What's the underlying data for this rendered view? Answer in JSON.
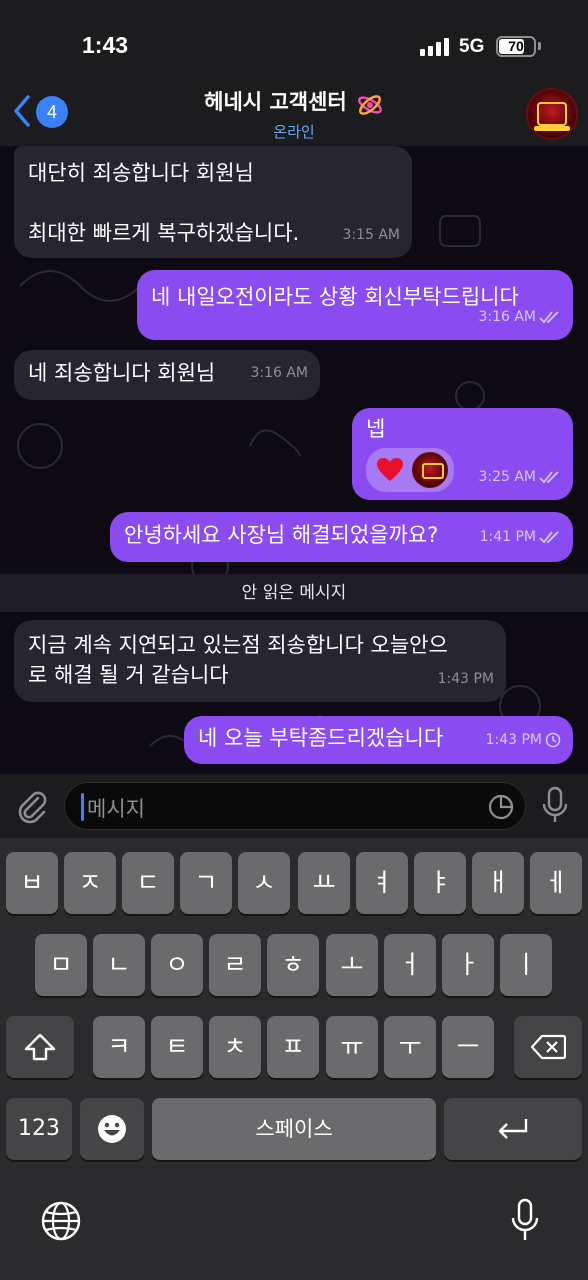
{
  "status_bar": {
    "time": "1:43",
    "network": "5G",
    "battery": "70"
  },
  "header": {
    "back_count": "4",
    "title": "헤네시 고객센터",
    "subtitle": "온라인"
  },
  "messages": [
    {
      "dir": "in",
      "lines": [
        "대단히 죄송합니다 회원님",
        "",
        "최대한 빠르게 복구하겠습니다."
      ],
      "time": "3:15 AM"
    },
    {
      "dir": "out",
      "lines": [
        "네 내일오전이라도 상황 회신부탁드립니다"
      ],
      "time": "3:16 AM",
      "status": "read"
    },
    {
      "dir": "in",
      "lines": [
        "네 죄송합니다 회원님"
      ],
      "time": "3:16 AM"
    },
    {
      "dir": "out",
      "lines": [
        "넵"
      ],
      "time": "3:25 AM",
      "status": "read",
      "reaction": "heart"
    },
    {
      "dir": "out",
      "lines": [
        "안녕하세요 사장님 해결되었을까요?"
      ],
      "time": "1:41 PM",
      "status": "read"
    },
    {
      "dir": "in",
      "lines": [
        "지금 계속 지연되고 있는점 죄송합니다 오늘안으",
        "로 해결 될 거 같습니다"
      ],
      "time": "1:43 PM"
    },
    {
      "dir": "out",
      "lines": [
        "네 오늘 부탁좀드리겠습니다"
      ],
      "time": "1:43 PM",
      "status": "pending"
    }
  ],
  "unread_divider": "안 읽은 메시지",
  "composer": {
    "placeholder": "메시지"
  },
  "keyboard": {
    "row1": [
      "ㅂ",
      "ㅈ",
      "ㄷ",
      "ㄱ",
      "ㅅ",
      "ㅛ",
      "ㅕ",
      "ㅑ",
      "ㅐ",
      "ㅔ"
    ],
    "row2": [
      "ㅁ",
      "ㄴ",
      "ㅇ",
      "ㄹ",
      "ㅎ",
      "ㅗ",
      "ㅓ",
      "ㅏ",
      "ㅣ"
    ],
    "row3": [
      "ㅋ",
      "ㅌ",
      "ㅊ",
      "ㅍ",
      "ㅠ",
      "ㅜ",
      "ㅡ"
    ],
    "numbers_key": "123",
    "space_key": "스페이스"
  },
  "colors": {
    "outgoing_bubble": "#8a4cf0",
    "incoming_bubble": "#272630",
    "accent_blue": "#3a82f7",
    "online_blue": "#6aa7f2"
  }
}
